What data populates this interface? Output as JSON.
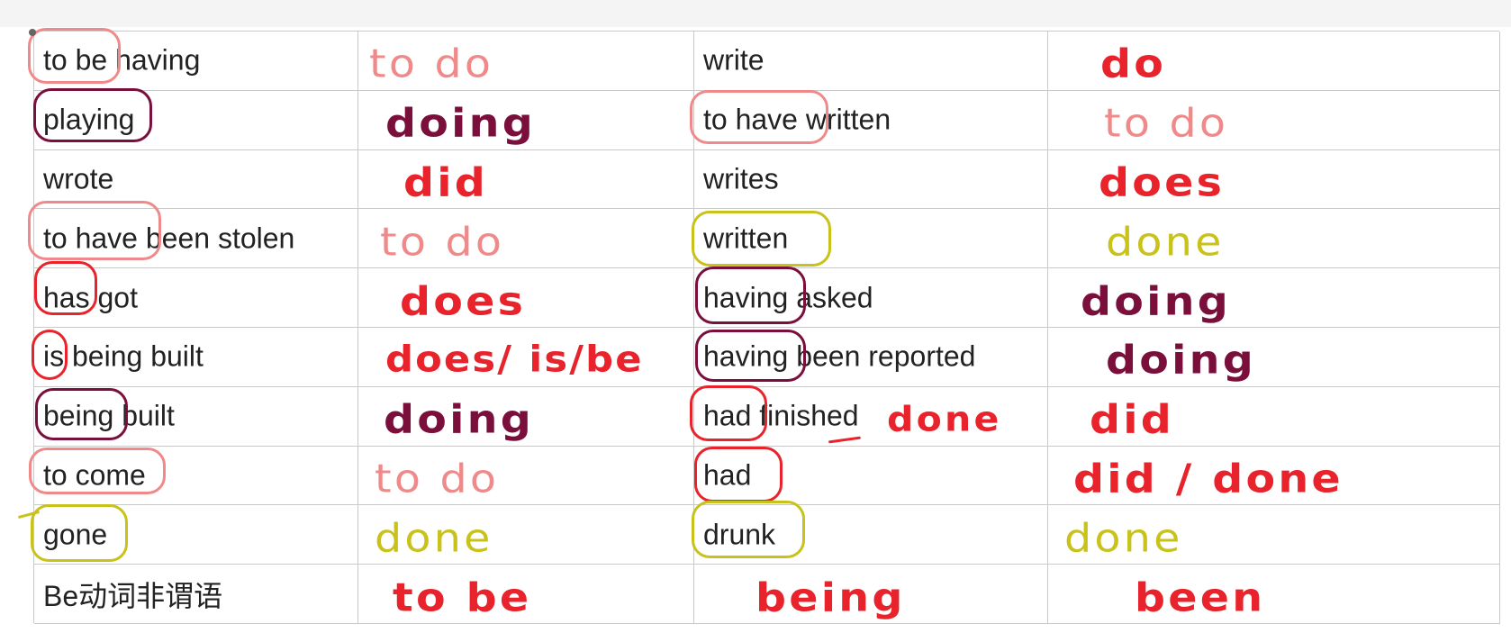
{
  "colors": {
    "red": "#e8232c",
    "pink": "#f08a8a",
    "maroon": "#7a0f3c",
    "yellow": "#c8c21a",
    "gridline": "#c9c9c9",
    "text": "#222222"
  },
  "rows": [
    {
      "c1": "to be having",
      "c1_hw": "to do",
      "c3": "write",
      "c4_hw": "do"
    },
    {
      "c1": "playing",
      "c1_hw": "doing",
      "c3": "to have written",
      "c4_hw": "to do"
    },
    {
      "c1": "wrote",
      "c1_hw": "did",
      "c3": "writes",
      "c4_hw": "does"
    },
    {
      "c1": "to have been stolen",
      "c1_hw": "to do",
      "c3": "written",
      "c4_hw": "done"
    },
    {
      "c1": "has got",
      "c1_hw": "does",
      "c3": "having asked",
      "c4_hw": "doing"
    },
    {
      "c1": "is being built",
      "c1_hw": "does/ is/be",
      "c3": "having been reported",
      "c4_hw": "doing"
    },
    {
      "c1": "being built",
      "c1_hw": "doing",
      "c3": "had finished",
      "c3_hw": "done",
      "c4_hw": "did"
    },
    {
      "c1": "to come",
      "c1_hw": "to do",
      "c3": "had",
      "c4_hw": "did / done"
    },
    {
      "c1": "gone",
      "c1_hw": "done",
      "c3": "drunk",
      "c4_hw": "done"
    },
    {
      "c1": "Be动词非谓语",
      "c1_hw": "to be",
      "c3_hw": "being",
      "c4_hw": "been"
    }
  ]
}
